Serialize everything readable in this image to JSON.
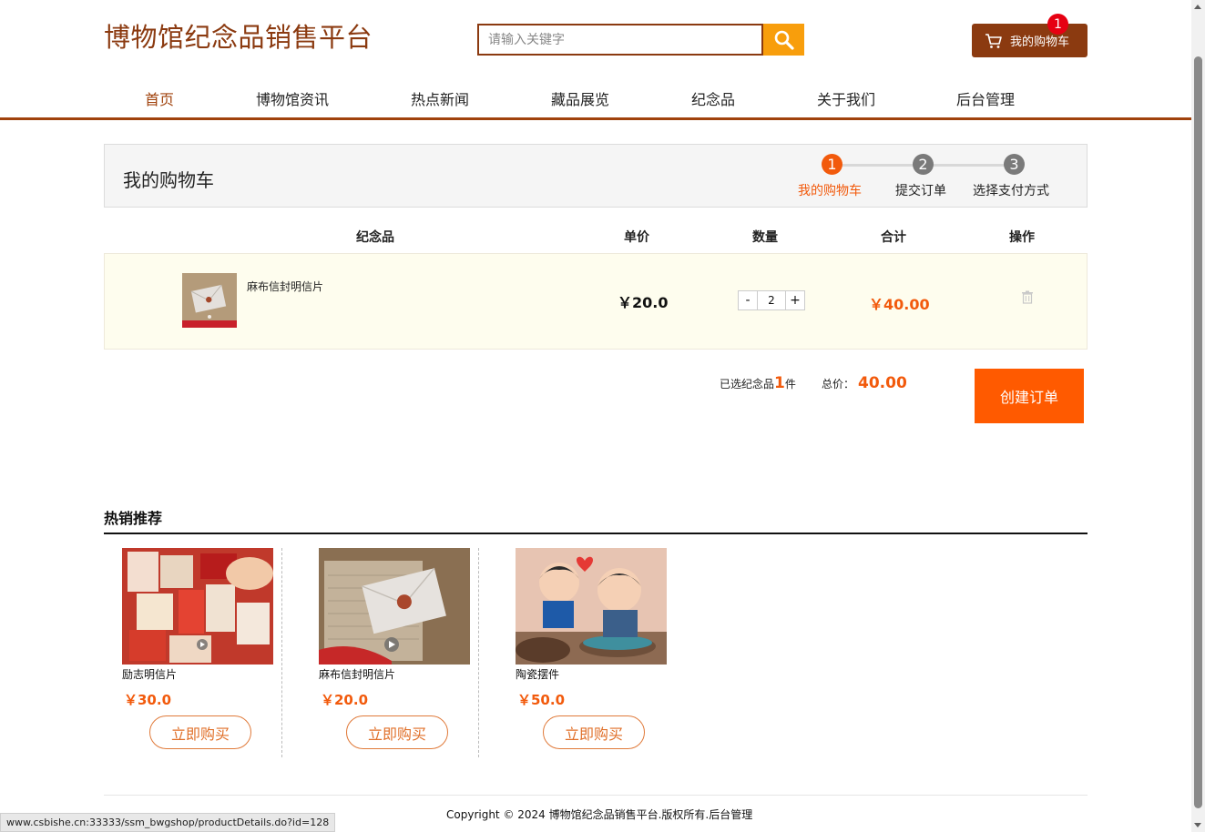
{
  "header": {
    "site_title": "博物馆纪念品销售平台",
    "search_placeholder": "请输入关键字",
    "cart_label": "我的购物车",
    "cart_count": "1"
  },
  "nav": {
    "items": [
      "首页",
      "博物馆资讯",
      "热点新闻",
      "藏品展览",
      "纪念品",
      "关于我们",
      "后台管理"
    ],
    "active_index": 0
  },
  "cart": {
    "title": "我的购物车",
    "steps": [
      {
        "num": "1",
        "label": "我的购物车",
        "active": true
      },
      {
        "num": "2",
        "label": "提交订单",
        "active": false
      },
      {
        "num": "3",
        "label": "选择支付方式",
        "active": false
      }
    ],
    "columns": [
      "纪念品",
      "单价",
      "数量",
      "合计",
      "操作"
    ],
    "items": [
      {
        "name": "麻布信封明信片",
        "unit_price": "￥20.0",
        "qty_minus": "-",
        "quantity": "2",
        "qty_plus": "+",
        "total": "￥40.00"
      }
    ],
    "selected_prefix": "已选纪念品",
    "selected_count": "1",
    "selected_suffix": "件",
    "total_label": "总价：",
    "total_value": "40.00",
    "create_order_label": "创建订单"
  },
  "recommend": {
    "title": "热销推荐",
    "items": [
      {
        "name": "励志明信片",
        "price": "￥30.0",
        "buy_label": "立即购买"
      },
      {
        "name": "麻布信封明信片",
        "price": "￥20.0",
        "buy_label": "立即购买"
      },
      {
        "name": "陶瓷摆件",
        "price": "￥50.0",
        "buy_label": "立即购买"
      }
    ]
  },
  "footer": {
    "copyright": "Copyright © 2024 博物馆纪念品销售平台.版权所有.后台管理"
  },
  "status_bar": {
    "url": "www.csbishe.cn:33333/ssm_bwgshop/productDetails.do?id=128"
  },
  "colors": {
    "brand_brown": "#8b3a10",
    "accent_orange": "#f25a0c",
    "search_yellow": "#f89e0c",
    "badge_red": "#e60012"
  }
}
